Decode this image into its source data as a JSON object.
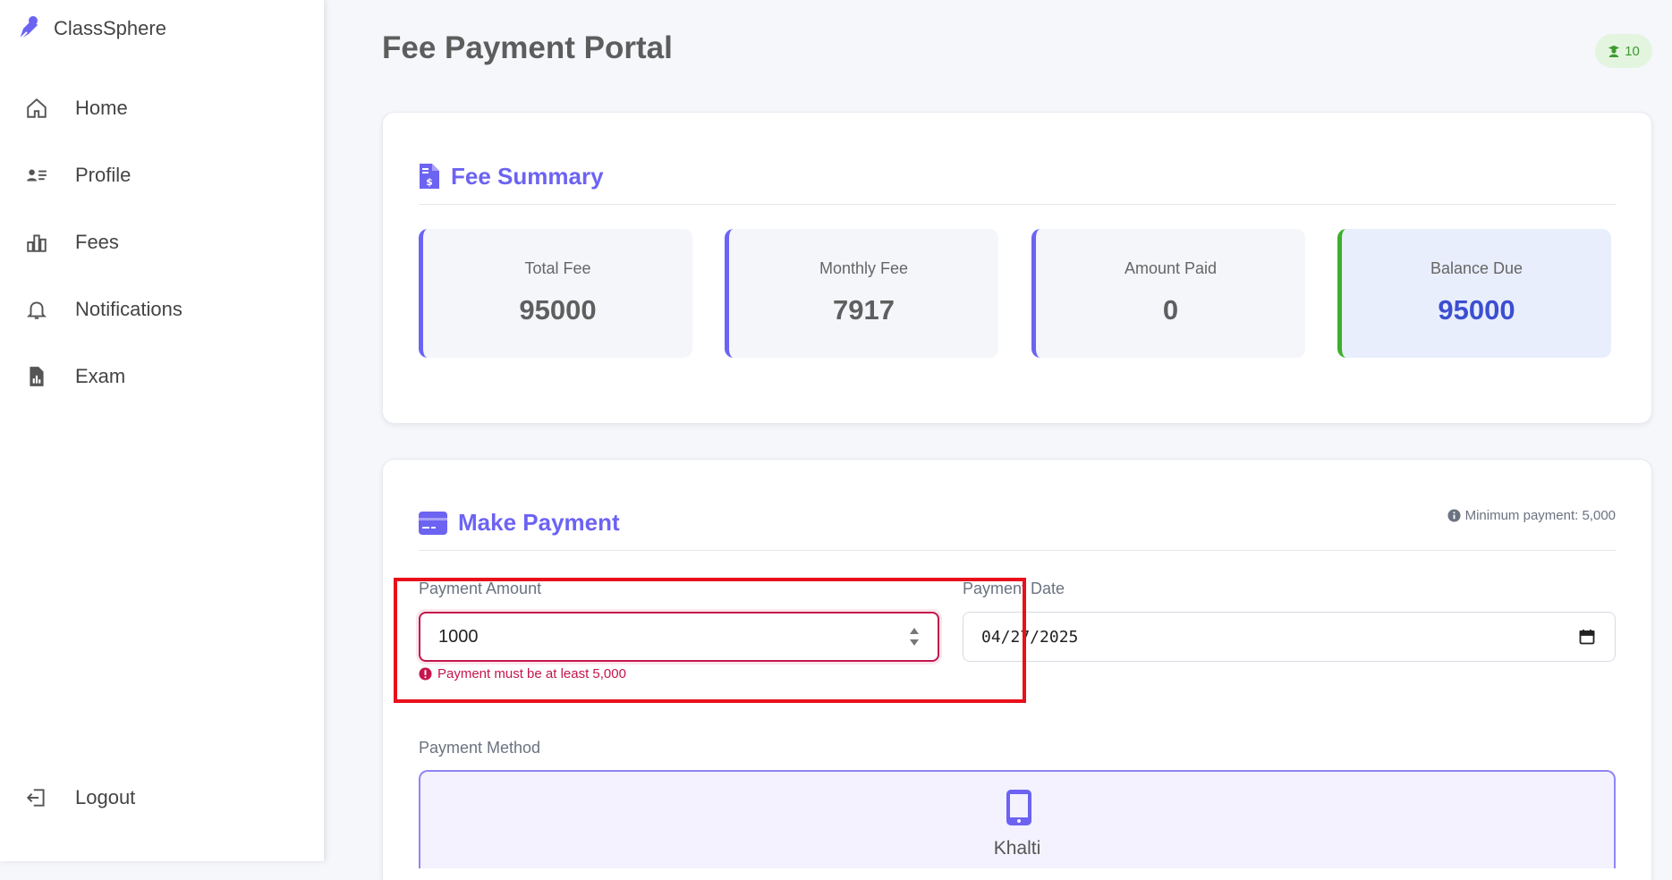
{
  "app": {
    "name": "ClassSphere"
  },
  "sidebar": {
    "items": [
      {
        "label": "Home",
        "icon": "home-icon"
      },
      {
        "label": "Profile",
        "icon": "profile-icon"
      },
      {
        "label": "Fees",
        "icon": "chart-icon"
      },
      {
        "label": "Notifications",
        "icon": "bell-icon"
      },
      {
        "label": "Exam",
        "icon": "report-icon"
      }
    ],
    "logout_label": "Logout"
  },
  "header": {
    "title": "Fee Payment Portal",
    "badge_count": "10"
  },
  "fee_summary": {
    "title": "Fee Summary",
    "stats": [
      {
        "label": "Total Fee",
        "value": "95000"
      },
      {
        "label": "Monthly Fee",
        "value": "7917"
      },
      {
        "label": "Amount Paid",
        "value": "0"
      },
      {
        "label": "Balance Due",
        "value": "95000"
      }
    ]
  },
  "payment": {
    "title": "Make Payment",
    "min_note": "Minimum payment: 5,000",
    "amount_label": "Payment Amount",
    "amount_value": "1000",
    "amount_error": "Payment must be at least 5,000",
    "date_label": "Payment Date",
    "date_value": "04/27/2025",
    "method_label": "Payment Method",
    "method_option": "Khalti"
  },
  "colors": {
    "accent": "#6c63f2",
    "error": "#c4164c",
    "success": "#3cb02c",
    "highlight": "#e8101b"
  }
}
